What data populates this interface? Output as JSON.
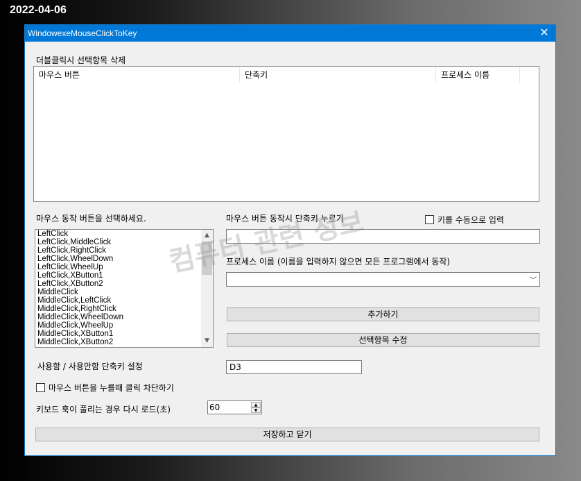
{
  "stamp": "2022-04-06",
  "window": {
    "title": "WindowexeMouseClickToKey",
    "close_glyph": "✕"
  },
  "section_delete_hint": "더블클릭시 선택항목 삭제",
  "listview": {
    "columns": [
      "마우스 버튼",
      "단축키",
      "프로세스 이름"
    ]
  },
  "mouse_select_label": "마우스 동작 버튼을 선택하세요.",
  "mouse_actions": [
    "LeftClick",
    "LeftClick,MiddleClick",
    "LeftClick,RightClick",
    "LeftClick,WheelDown",
    "LeftClick,WheelUp",
    "LeftClick,XButton1",
    "LeftClick,XButton2",
    "MiddleClick",
    "MiddleClick,LeftClick",
    "MiddleClick,RightClick",
    "MiddleClick,WheelDown",
    "MiddleClick,WheelUp",
    "MiddleClick,XButton1",
    "MiddleClick,XButton2"
  ],
  "shortcut_label": "마우스 버튼 동작시 단축키 누르기",
  "manual_key_checkbox": "키를 수동으로 입력",
  "shortcut_value": "",
  "process_label": "프로세스 이름 (이름을 입력하지 않으면 모든 프로그램에서 동작)",
  "process_value": "",
  "add_button": "추가하기",
  "edit_button": "선택항목 수정",
  "toggle_label": "사용함 / 사용안함 단축키 설정",
  "toggle_value": "D3",
  "block_click_checkbox": "마우스 버튼을 누를때 클릭 차단하기",
  "reload_label": "키보드 훅이 풀리는 경우 다시 로드(초)",
  "reload_value": "60",
  "save_button": "저장하고 닫기",
  "watermark": "컴퓨터 관련 정보",
  "icons": {
    "scroll_up": "▲",
    "scroll_down": "▼",
    "dropdown": "﹀"
  }
}
